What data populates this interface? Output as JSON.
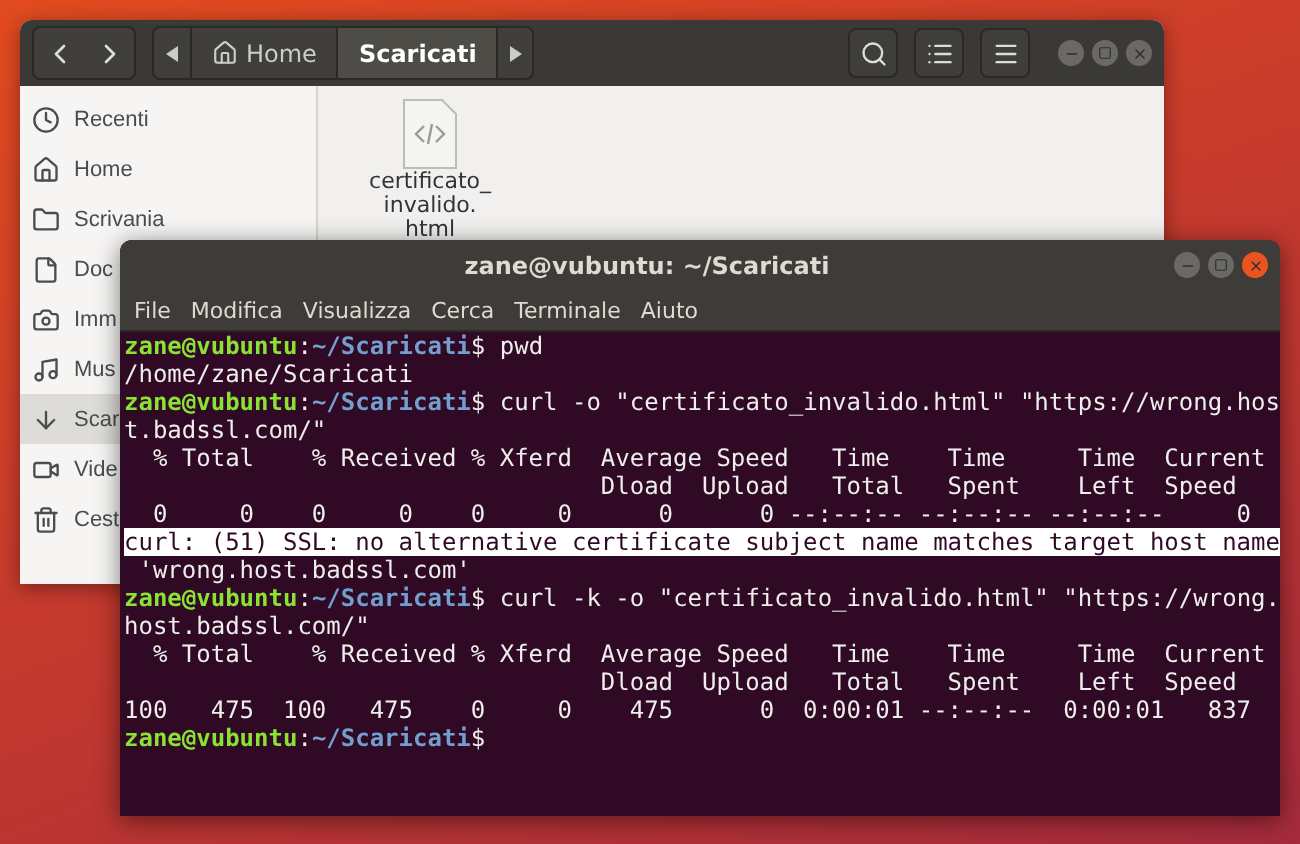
{
  "files_window": {
    "path_bar": [
      {
        "label": "Home",
        "selected": false
      },
      {
        "label": "Scaricati",
        "selected": true
      }
    ],
    "sidebar": {
      "items": [
        {
          "label": "Recenti",
          "selected": false
        },
        {
          "label": "Home",
          "selected": false
        },
        {
          "label": "Scrivania",
          "selected": false
        },
        {
          "label": "Doc",
          "selected": false
        },
        {
          "label": "Imm",
          "selected": false
        },
        {
          "label": "Mus",
          "selected": false
        },
        {
          "label": "Scar",
          "selected": true
        },
        {
          "label": "Vide",
          "selected": false
        },
        {
          "label": "Cest",
          "selected": false
        }
      ]
    },
    "files": [
      {
        "name_lines": [
          "certificato_",
          "invalido.",
          "html"
        ]
      }
    ]
  },
  "terminal": {
    "title": "zane@vubuntu: ~/Scaricati",
    "menu": [
      "File",
      "Modifica",
      "Visualizza",
      "Cerca",
      "Terminale",
      "Aiuto"
    ],
    "lines": [
      {
        "kind": "prompt",
        "user": "zane@vubuntu",
        "sep": ":",
        "path": "~/Scaricati",
        "command": "$ pwd"
      },
      {
        "kind": "output",
        "text": "/home/zane/Scaricati",
        "selected": false
      },
      {
        "kind": "prompt",
        "user": "zane@vubuntu",
        "sep": ":",
        "path": "~/Scaricati",
        "command": "$ curl -o \"certificato_invalido.html\" \"https://wrong.hos"
      },
      {
        "kind": "output",
        "text": "t.badssl.com/\"",
        "selected": false
      },
      {
        "kind": "output",
        "text": "  % Total    % Received % Xferd  Average Speed   Time    Time     Time  Current",
        "selected": false
      },
      {
        "kind": "output",
        "text": "                                 Dload  Upload   Total   Spent    Left  Speed",
        "selected": false
      },
      {
        "kind": "output",
        "text": "  0     0    0     0    0     0      0      0 --:--:-- --:--:-- --:--:--     0",
        "selected": false
      },
      {
        "kind": "output",
        "text": "curl: (51) SSL: no alternative certificate subject name matches target host name",
        "selected": true
      },
      {
        "kind": "output",
        "text": " 'wrong.host.badssl.com'",
        "selected": false
      },
      {
        "kind": "prompt",
        "user": "zane@vubuntu",
        "sep": ":",
        "path": "~/Scaricati",
        "command": "$ curl -k -o \"certificato_invalido.html\" \"https://wrong."
      },
      {
        "kind": "output",
        "text": "host.badssl.com/\"",
        "selected": false
      },
      {
        "kind": "output",
        "text": "  % Total    % Received % Xferd  Average Speed   Time    Time     Time  Current",
        "selected": false
      },
      {
        "kind": "output",
        "text": "                                 Dload  Upload   Total   Spent    Left  Speed",
        "selected": false
      },
      {
        "kind": "output",
        "text": "100   475  100   475    0     0    475      0  0:00:01 --:--:--  0:00:01   837",
        "selected": false
      },
      {
        "kind": "prompt",
        "user": "zane@vubuntu",
        "sep": ":",
        "path": "~/Scaricati",
        "command": "$"
      }
    ]
  }
}
